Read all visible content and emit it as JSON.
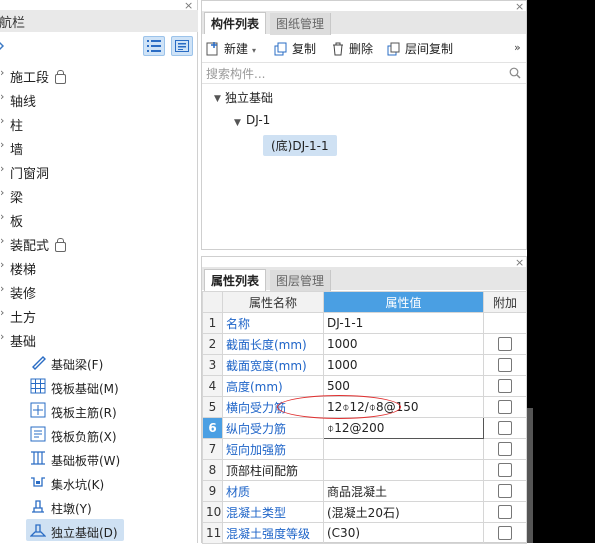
{
  "nav": {
    "title": "导航栏",
    "close": "×",
    "pin": "",
    "items": [
      {
        "label": "施工段",
        "locked": true
      },
      {
        "label": "轴线"
      },
      {
        "label": "柱"
      },
      {
        "label": "墙"
      },
      {
        "label": "门窗洞"
      },
      {
        "label": "梁"
      },
      {
        "label": "板"
      },
      {
        "label": "装配式",
        "locked": true
      },
      {
        "label": "楼梯"
      },
      {
        "label": "装修"
      },
      {
        "label": "土方"
      },
      {
        "label": "基础"
      }
    ],
    "sub_items": [
      {
        "label": "基础梁(F)",
        "icon": "foundation-beam-icon"
      },
      {
        "label": "筏板基础(M)",
        "icon": "raft-foundation-icon"
      },
      {
        "label": "筏板主筋(R)",
        "icon": "raft-main-rebar-icon"
      },
      {
        "label": "筏板负筋(X)",
        "icon": "raft-negative-rebar-icon"
      },
      {
        "label": "基础板带(W)",
        "icon": "foundation-strip-icon"
      },
      {
        "label": "集水坑(K)",
        "icon": "sump-pit-icon"
      },
      {
        "label": "柱墩(Y)",
        "icon": "column-pier-icon"
      },
      {
        "label": "独立基础(D)",
        "icon": "isolated-footing-icon",
        "selected": true
      }
    ]
  },
  "components": {
    "tabs": [
      "构件列表",
      "图纸管理"
    ],
    "close": "×",
    "toolbar": {
      "new": "新建",
      "copy": "复制",
      "delete": "删除",
      "floor_copy": "层间复制",
      "more": "»"
    },
    "search_placeholder": "搜索构件...",
    "tree": {
      "root": "独立基础",
      "child": "DJ-1",
      "leaf": "(底)DJ-1-1"
    }
  },
  "properties": {
    "tabs": [
      "属性列表",
      "图层管理"
    ],
    "close": "×",
    "headers": [
      "",
      "属性名称",
      "属性值",
      "附加"
    ],
    "rows": [
      {
        "num": "1",
        "name": "名称",
        "value": "DJ-1-1",
        "blue": true,
        "check": false
      },
      {
        "num": "2",
        "name": "截面长度(mm)",
        "value": "1000",
        "blue": true,
        "check": true
      },
      {
        "num": "3",
        "name": "截面宽度(mm)",
        "value": "1000",
        "blue": true,
        "check": true
      },
      {
        "num": "4",
        "name": "高度(mm)",
        "value": "500",
        "blue": true,
        "check": true
      },
      {
        "num": "5",
        "name": "横向受力筋",
        "value": "12⌽12/⌽8@150",
        "blue": true,
        "check": true
      },
      {
        "num": "6",
        "name": "纵向受力筋",
        "value": "⌽12@200",
        "blue": true,
        "check": true,
        "active": true
      },
      {
        "num": "7",
        "name": "短向加强筋",
        "value": "",
        "blue": true,
        "check": true
      },
      {
        "num": "8",
        "name": "顶部柱间配筋",
        "value": "",
        "blue": false,
        "check": true
      },
      {
        "num": "9",
        "name": "材质",
        "value": "商品混凝土",
        "blue": true,
        "check": true
      },
      {
        "num": "10",
        "name": "混凝土类型",
        "value": "(混凝土20石)",
        "blue": true,
        "check": true
      },
      {
        "num": "11",
        "name": "混凝土强度等级",
        "value": "(C30)",
        "blue": true,
        "check": true
      }
    ]
  },
  "colors": {
    "accent": "#4a9fe3",
    "selection": "#cfe1f3",
    "link_blue": "#1e64c8",
    "annotation_red": "#e03030"
  }
}
